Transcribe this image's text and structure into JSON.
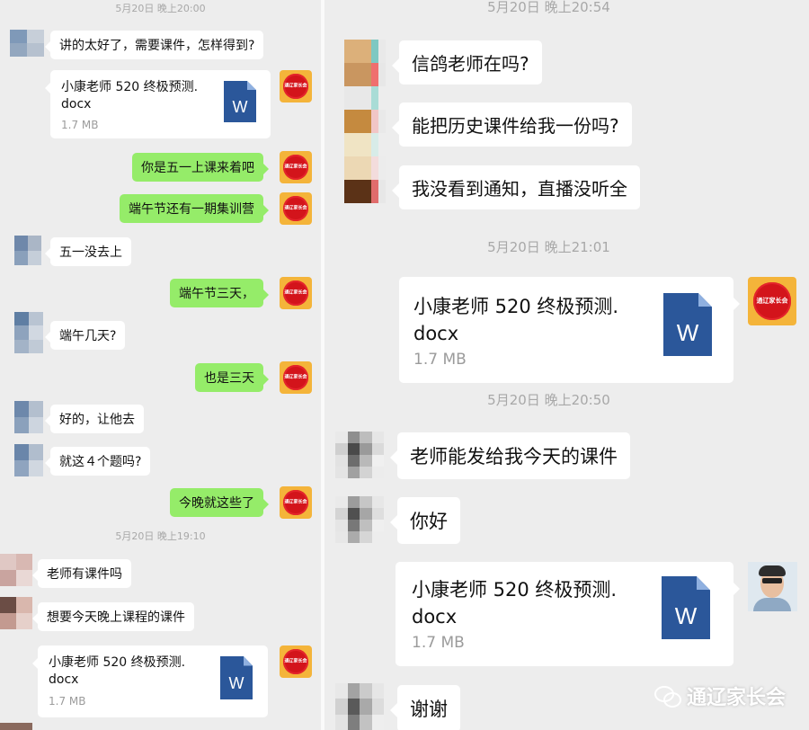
{
  "colors": {
    "bg": "#ededed",
    "green_bubble": "#95ec69",
    "white_bubble": "#ffffff",
    "timestamp": "#a8a8a8",
    "word_blue": "#2b579a",
    "seal_red": "#d3141b",
    "seal_gold": "#f4b43a"
  },
  "left": {
    "timestamps": [
      "5月20日 晚上20:00",
      "5月20日 晚上19:10"
    ],
    "messages": [
      "讲的太好了，需要课件，怎样得到?",
      "你是五一上课来着吧",
      "端午节还有一期集训营",
      "五一没去上",
      "端午节三天，",
      "端午几天?",
      "也是三天",
      "好的，让他去",
      "就这４个题吗?",
      "今晚就这些了",
      "老师有课件吗",
      "想要今天晚上课程的课件"
    ],
    "files": [
      {
        "name_line1": "小康老师 520 终极预测.",
        "name_line2": "docx",
        "size": "1.7 MB"
      },
      {
        "name_line1": "小康老师 520 终极预测.",
        "name_line2": "docx",
        "size": "1.7 MB"
      }
    ]
  },
  "right": {
    "timestamps": [
      "5月20日 晚上20:54",
      "5月20日 晚上21:01",
      "5月20日 晚上20:50"
    ],
    "messages": [
      "信鸽老师在吗?",
      "能把历史课件给我一份吗?",
      "我没看到通知，直播没听全",
      "老师能发给我今天的课件",
      "你好",
      "谢谢"
    ],
    "files": [
      {
        "name_line1": "小康老师 520 终极预测.",
        "name_line2": "docx",
        "size": "1.7 MB"
      },
      {
        "name_line1": "小康老师 520 终极预测.",
        "name_line2": "docx",
        "size": "1.7 MB"
      }
    ]
  },
  "icons": {
    "word_letter": "W",
    "seal_text": "通辽家长会"
  },
  "watermark": {
    "text": "通辽家长会"
  }
}
